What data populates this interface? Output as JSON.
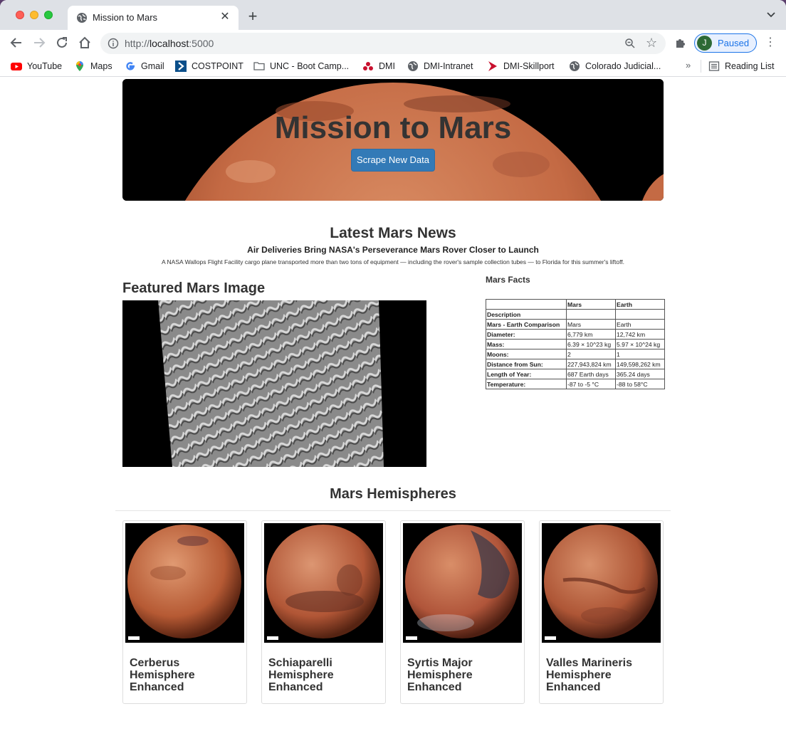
{
  "browser": {
    "tab_title": "Mission to Mars",
    "url_scheme": "http://",
    "url_host": "localhost",
    "url_port": ":5000",
    "profile_initial": "J",
    "profile_label": "Paused",
    "bookmarks": [
      {
        "label": "YouTube",
        "icon": "youtube-icon"
      },
      {
        "label": "Maps",
        "icon": "maps-pin-icon"
      },
      {
        "label": "Gmail",
        "icon": "google-g-icon"
      },
      {
        "label": "COSTPOINT",
        "icon": "costpoint-icon"
      },
      {
        "label": "UNC - Boot Camp...",
        "icon": "folder-icon"
      },
      {
        "label": "DMI",
        "icon": "dmi-icon"
      },
      {
        "label": "DMI-Intranet",
        "icon": "globe-icon"
      },
      {
        "label": "DMI-Skillport",
        "icon": "skillport-icon"
      },
      {
        "label": "Colorado Judicial...",
        "icon": "globe-icon"
      }
    ],
    "bookmarks_overflow": "»",
    "reading_list": "Reading List"
  },
  "hero": {
    "title": "Mission to Mars",
    "button": "Scrape New Data"
  },
  "news": {
    "heading": "Latest Mars News",
    "title": "Air Deliveries Bring NASA's Perseverance Mars Rover Closer to Launch",
    "paragraph": "A NASA Wallops Flight Facility cargo plane transported more than two tons of equipment — including the rover's sample collection tubes — to Florida for this summer's liftoff."
  },
  "featured": {
    "heading": "Featured Mars Image"
  },
  "facts": {
    "heading": "Mars Facts",
    "columns": [
      "",
      "Mars",
      "Earth"
    ],
    "rows": [
      [
        "Description",
        "",
        ""
      ],
      [
        "Mars - Earth Comparison",
        "Mars",
        "Earth"
      ],
      [
        "Diameter:",
        "6,779 km",
        "12,742 km"
      ],
      [
        "Mass:",
        "6.39 × 10^23 kg",
        "5.97 × 10^24 kg"
      ],
      [
        "Moons:",
        "2",
        "1"
      ],
      [
        "Distance from Sun:",
        "227,943,824 km",
        "149,598,262 km"
      ],
      [
        "Length of Year:",
        "687 Earth days",
        "365.24 days"
      ],
      [
        "Temperature:",
        "-87 to -5 °C",
        "-88 to 58°C"
      ]
    ]
  },
  "hemispheres": {
    "heading": "Mars Hemispheres",
    "items": [
      {
        "title": "Cerberus Hemisphere Enhanced"
      },
      {
        "title": "Schiaparelli Hemisphere Enhanced"
      },
      {
        "title": "Syrtis Major Hemisphere Enhanced"
      },
      {
        "title": "Valles Marineris Hemisphere Enhanced"
      }
    ]
  }
}
